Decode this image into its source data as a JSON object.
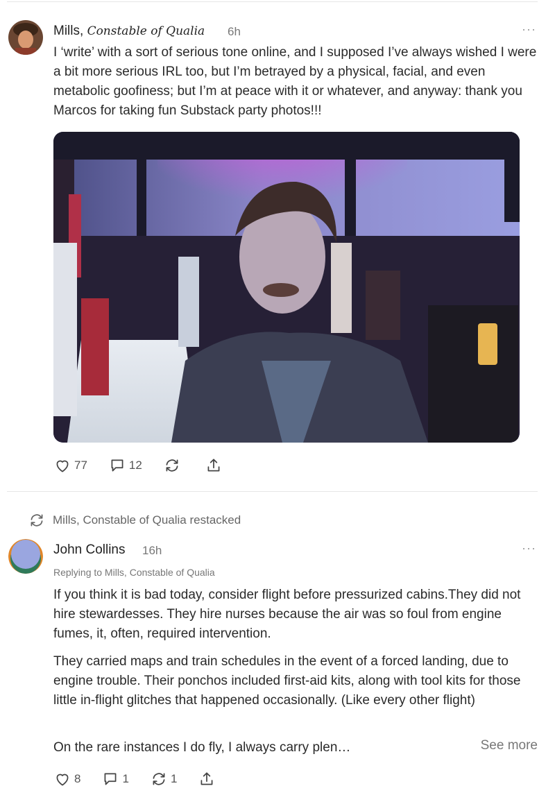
{
  "post": {
    "author_name": "Mills,",
    "author_handle": "Constable of Qualia",
    "time": "6h",
    "more": "···",
    "text": "I ‘write’ with a sort of serious tone online, and I supposed I’ve always wished I were a bit more serious IRL too, but I’m betrayed by a physical, facial, and even metabolic goofiness; but I’m at peace with it or whatever, and anyway: thank you Marcos for taking fun Substack party photos!!!",
    "likes": "77",
    "comments": "12"
  },
  "restack": {
    "label": "Mills, Constable of Qualia restacked"
  },
  "comment": {
    "author_name": "John Collins",
    "time": "16h",
    "more": "···",
    "replying_to": "Replying to Mills, Constable of Qualia",
    "paragraphs": [
      "If you think it is bad today, consider flight before pressurized cabins.They did not hire stewardesses. They hire nurses because the air was so foul from engine fumes, it, often, required intervention.",
      "They carried maps and train schedules in the event of a forced landing, due to engine trouble. Their ponchos included first-aid kits, along with tool kits for those little in-flight glitches that happened occasionally. (Like every other flight)",
      "On the rare instances I do fly, I always carry plen…"
    ],
    "see_more": "See more",
    "likes": "8",
    "comments": "1",
    "restacks": "1"
  },
  "colors": {
    "divider": "#e6e6e6",
    "text": "#2a2a2a",
    "muted": "#777777"
  }
}
